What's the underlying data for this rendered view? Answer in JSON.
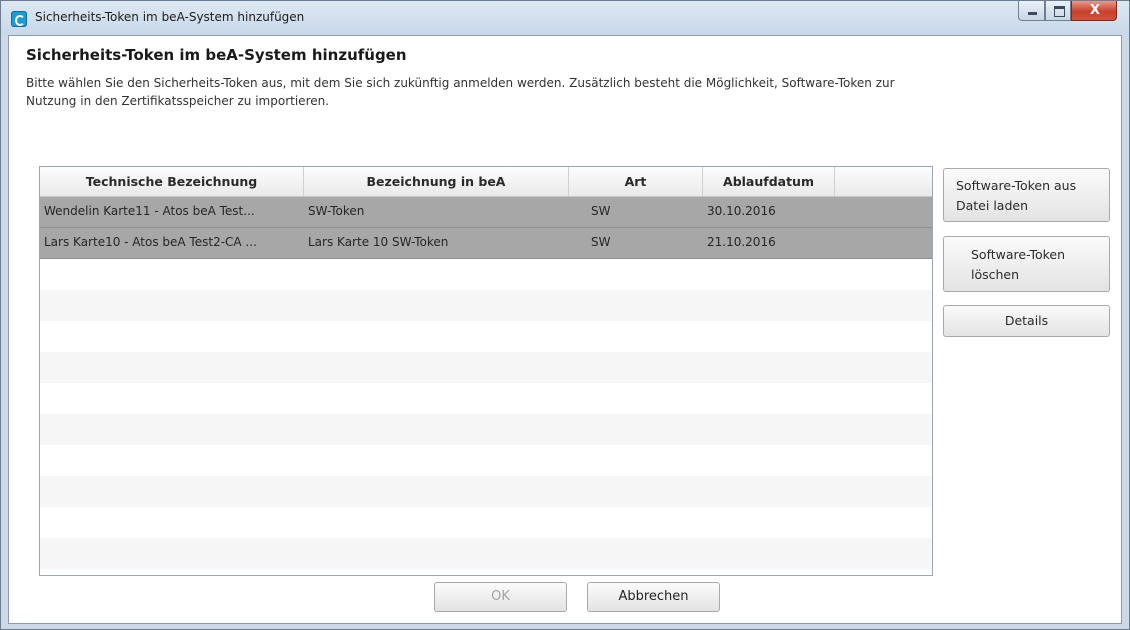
{
  "window": {
    "title": "Sicherheits-Token im beA-System hinzufügen",
    "controls": {
      "minimize_icon": "minimize-icon",
      "maximize_icon": "maximize-icon",
      "close_label": "X"
    }
  },
  "header": {
    "heading": "Sicherheits-Token im beA-System hinzufügen",
    "description": "Bitte wählen Sie den Sicherheits-Token aus, mit dem Sie sich zukünftig anmelden werden. Zusätzlich besteht die Möglichkeit, Software-Token zur Nutzung in den Zertifikatsspeicher zu importieren."
  },
  "table": {
    "columns": [
      "Technische Bezeichnung",
      "Bezeichnung in beA",
      "Art",
      "Ablaufdatum"
    ],
    "rows": [
      [
        "Wendelin Karte11 - Atos beA Test...",
        "SW-Token",
        "SW",
        "30.10.2016"
      ],
      [
        "Lars Karte10 - Atos beA Test2-CA ...",
        "Lars Karte 10 SW-Token",
        "SW",
        "21.10.2016"
      ]
    ]
  },
  "side_buttons": {
    "load": "Software-Token aus Datei laden",
    "delete": "Software-Token löschen",
    "details": "Details"
  },
  "footer": {
    "ok": "OK",
    "cancel": "Abbrechen"
  },
  "colors": {
    "selected_row": "#a7a7a7",
    "title_icon": "#1b9ad6",
    "close_button": "#c7402b"
  }
}
